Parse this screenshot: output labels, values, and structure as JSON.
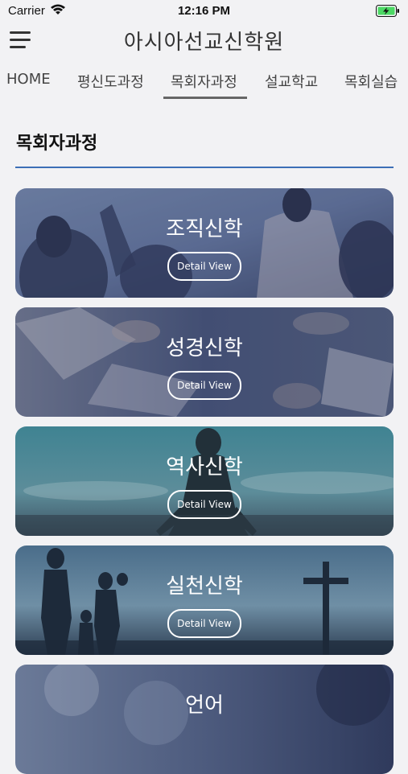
{
  "status_bar": {
    "carrier": "Carrier",
    "time": "12:16 PM"
  },
  "header": {
    "title": "아시아선교신학원",
    "menu_icon": "hamburger-menu-icon"
  },
  "tabs": [
    {
      "label": "HOME"
    },
    {
      "label": "평신도과정"
    },
    {
      "label": "목회자과정",
      "active": true
    },
    {
      "label": "설교학교"
    },
    {
      "label": "목회실습"
    }
  ],
  "section": {
    "title": "목회자과정"
  },
  "cards": [
    {
      "title": "조직신학",
      "button": "Detail View"
    },
    {
      "title": "성경신학",
      "button": "Detail View"
    },
    {
      "title": "역사신학",
      "button": "Detail View"
    },
    {
      "title": "실천신학",
      "button": "Detail View"
    },
    {
      "title": "언어"
    }
  ],
  "colors": {
    "accent": "#3d6fb6",
    "background": "#f2f2f4",
    "battery": "#4cd964"
  }
}
